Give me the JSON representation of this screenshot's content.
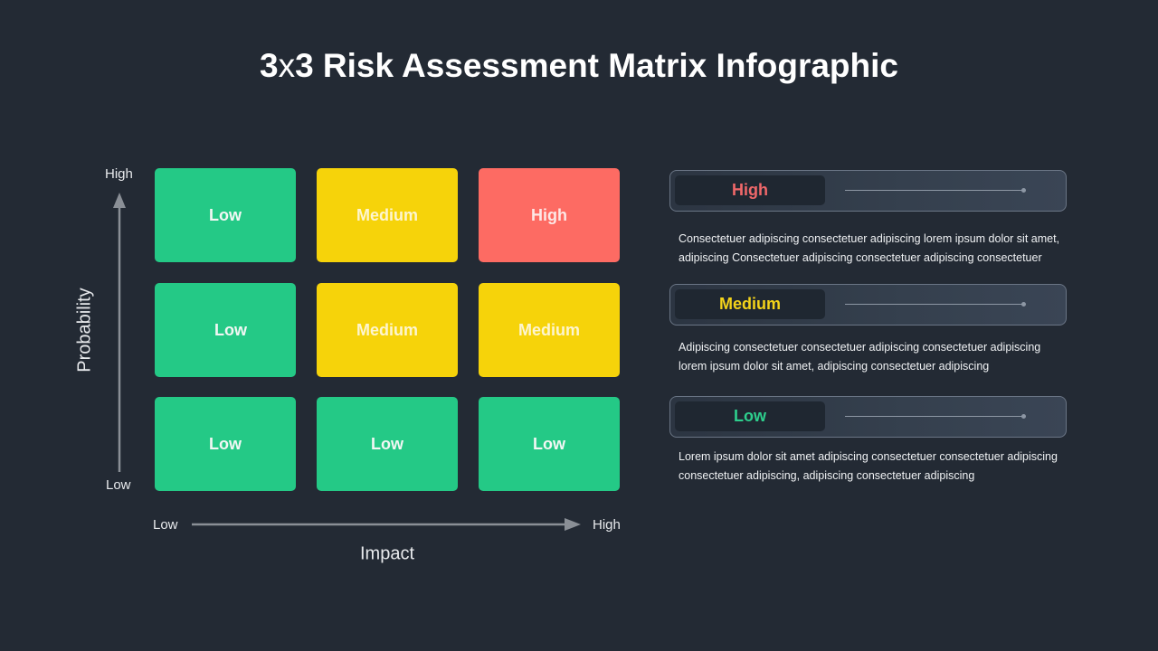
{
  "title": {
    "prefix": "3",
    "x": "x",
    "suffix": "3 Risk Assessment Matrix Infographic"
  },
  "colors": {
    "background": "#232a34",
    "low": "#24c986",
    "medium": "#f6d30a",
    "high": "#fd6b63",
    "low_text": "#2ecf8d",
    "medium_text": "#f3d31a",
    "high_text": "#f0686a"
  },
  "matrix": {
    "y_axis": {
      "title": "Probability",
      "high_label": "High",
      "low_label": "Low"
    },
    "x_axis": {
      "title": "Impact",
      "low_label": "Low",
      "high_label": "High"
    },
    "rows": [
      {
        "probability": "High",
        "cells": [
          {
            "impact": "Low",
            "label": "Low",
            "level": "low"
          },
          {
            "impact": "Medium",
            "label": "Medium",
            "level": "medium"
          },
          {
            "impact": "High",
            "label": "High",
            "level": "high"
          }
        ]
      },
      {
        "probability": "Medium",
        "cells": [
          {
            "impact": "Low",
            "label": "Low",
            "level": "low"
          },
          {
            "impact": "Medium",
            "label": "Medium",
            "level": "medium"
          },
          {
            "impact": "High",
            "label": "Medium",
            "level": "medium"
          }
        ]
      },
      {
        "probability": "Low",
        "cells": [
          {
            "impact": "Low",
            "label": "Low",
            "level": "low"
          },
          {
            "impact": "Medium",
            "label": "Low",
            "level": "low"
          },
          {
            "impact": "High",
            "label": "Low",
            "level": "low"
          }
        ]
      }
    ]
  },
  "legend": [
    {
      "label": "High",
      "level": "high",
      "description_line1": "Consectetuer adipiscing consectetuer adipiscing lorem ipsum dolor sit amet,",
      "description_line2": "adipiscing Consectetuer adipiscing consectetuer adipiscing consectetuer"
    },
    {
      "label": "Medium",
      "level": "medium",
      "description_line1": "Adipiscing consectetuer consectetuer adipiscing consectetuer adipiscing",
      "description_line2": "lorem ipsum dolor sit amet, adipiscing consectetuer adipiscing"
    },
    {
      "label": "Low",
      "level": "low",
      "description_line1": "Lorem ipsum dolor sit amet adipiscing consectetuer consectetuer adipiscing",
      "description_line2": "consectetuer adipiscing, adipiscing consectetuer adipiscing"
    }
  ]
}
